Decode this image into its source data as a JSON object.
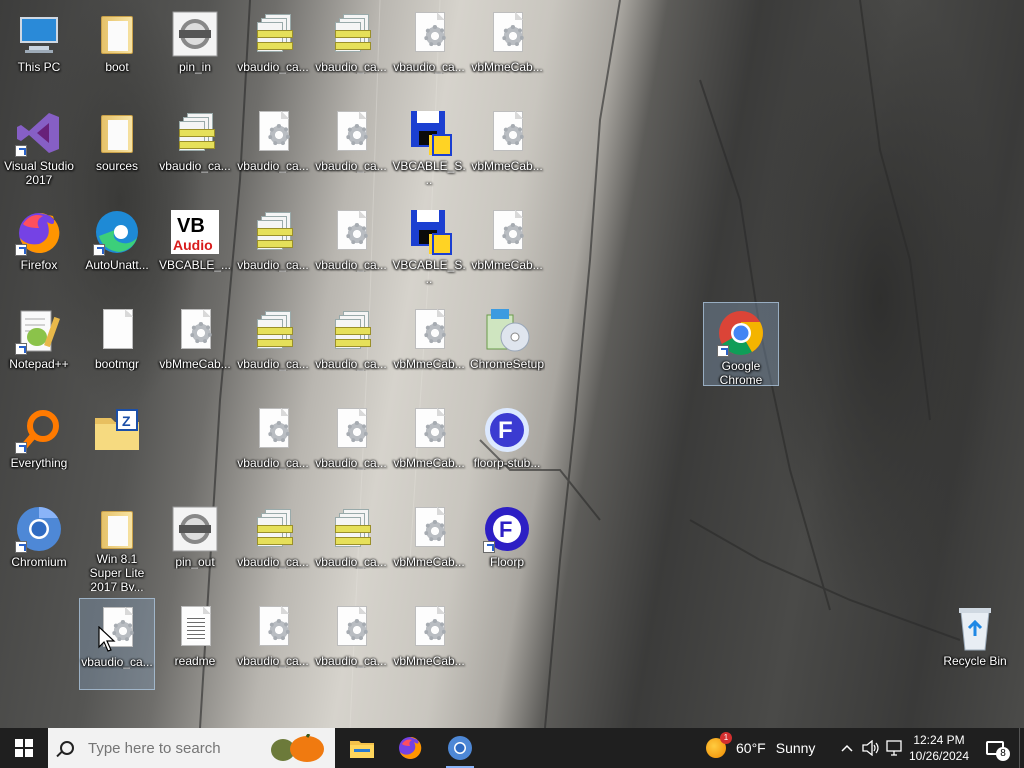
{
  "desktop": {
    "icons": [
      {
        "label": "This PC",
        "kind": "computer"
      },
      {
        "label": "boot",
        "kind": "folder"
      },
      {
        "label": "pin_in",
        "kind": "audio"
      },
      {
        "label": "vbaudio_ca...",
        "kind": "cab"
      },
      {
        "label": "vbaudio_ca...",
        "kind": "cab"
      },
      {
        "label": "vbaudio_ca...",
        "kind": "setup"
      },
      {
        "label": "vbMmeCab...",
        "kind": "setup"
      },
      {
        "label": "Visual Studio 2017",
        "kind": "vs"
      },
      {
        "label": "sources",
        "kind": "folder"
      },
      {
        "label": "vbaudio_ca...",
        "kind": "cab"
      },
      {
        "label": "vbaudio_ca...",
        "kind": "setup"
      },
      {
        "label": "vbaudio_ca...",
        "kind": "setup"
      },
      {
        "label": "VBCABLE_S...",
        "kind": "installer"
      },
      {
        "label": "vbMmeCab...",
        "kind": "setup"
      },
      {
        "label": "Firefox",
        "kind": "firefox"
      },
      {
        "label": "AutoUnatt...",
        "kind": "edge"
      },
      {
        "label": "VBCABLE_...",
        "kind": "vbaudio"
      },
      {
        "label": "vbaudio_ca...",
        "kind": "cab"
      },
      {
        "label": "vbaudio_ca...",
        "kind": "setup"
      },
      {
        "label": "VBCABLE_S...",
        "kind": "installer"
      },
      {
        "label": "vbMmeCab...",
        "kind": "setup"
      },
      {
        "label": "Notepad++",
        "kind": "notepad"
      },
      {
        "label": "bootmgr",
        "kind": "blank"
      },
      {
        "label": "vbMmeCab...",
        "kind": "setup"
      },
      {
        "label": "vbaudio_ca...",
        "kind": "cab"
      },
      {
        "label": "vbaudio_ca...",
        "kind": "cab"
      },
      {
        "label": "vbMmeCab...",
        "kind": "setup"
      },
      {
        "label": "ChromeSetup",
        "kind": "chromesetup"
      },
      {
        "label": "Everything",
        "kind": "everything"
      },
      {
        "label": "",
        "kind": "zipfolder"
      },
      {
        "label": "vbaudio_ca...",
        "kind": "setup"
      },
      {
        "label": "vbaudio_ca...",
        "kind": "setup"
      },
      {
        "label": "vbMmeCab...",
        "kind": "setup"
      },
      {
        "label": "floorp-stub...",
        "kind": "floorpstub"
      },
      {
        "label": "Chromium",
        "kind": "chromium"
      },
      {
        "label": "Win 8.1 Super Lite 2017 By...",
        "kind": "folder"
      },
      {
        "label": "pin_out",
        "kind": "audio"
      },
      {
        "label": "vbaudio_ca...",
        "kind": "cab"
      },
      {
        "label": "vbaudio_ca...",
        "kind": "cab"
      },
      {
        "label": "vbMmeCab...",
        "kind": "setup"
      },
      {
        "label": "Floorp",
        "kind": "floorp"
      },
      {
        "label": "vbaudio_ca...",
        "kind": "setup"
      },
      {
        "label": "readme",
        "kind": "text"
      },
      {
        "label": "vbaudio_ca...",
        "kind": "setup"
      },
      {
        "label": "vbaudio_ca...",
        "kind": "setup"
      },
      {
        "label": "vbMmeCab...",
        "kind": "setup"
      },
      {
        "label": "Google Chrome",
        "kind": "chrome"
      },
      {
        "label": "Recycle Bin",
        "kind": "recycle"
      }
    ]
  },
  "taskbar": {
    "search_placeholder": "Type here to search",
    "pinned": [
      "file-explorer",
      "firefox",
      "chromium"
    ],
    "weather": {
      "temp": "60°F",
      "condition": "Sunny",
      "badge": "1"
    },
    "clock": {
      "time": "12:24 PM",
      "date": "10/26/2024"
    },
    "notifications": "8"
  },
  "colors": {
    "taskbar": "#1f1f1f",
    "accent": "#0078d7",
    "selection": "#8caac8"
  }
}
